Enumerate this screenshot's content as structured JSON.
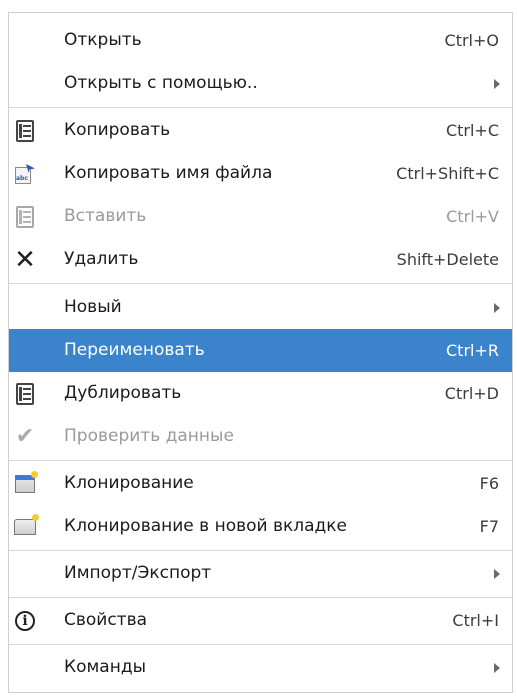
{
  "menu": {
    "items": [
      {
        "label": "Открыть",
        "shortcut": "Ctrl+O",
        "icon": "",
        "disabled": false,
        "submenu": false
      },
      {
        "label": "Открыть с помощью..",
        "shortcut": "",
        "icon": "",
        "disabled": false,
        "submenu": true
      },
      {
        "label": "Копировать",
        "shortcut": "Ctrl+C",
        "icon": "copy-icon",
        "disabled": false,
        "submenu": false
      },
      {
        "label": "Копировать имя файла",
        "shortcut": "Ctrl+Shift+C",
        "icon": "copy-filename-icon",
        "disabled": false,
        "submenu": false
      },
      {
        "label": "Вставить",
        "shortcut": "Ctrl+V",
        "icon": "paste-icon",
        "disabled": true,
        "submenu": false
      },
      {
        "label": "Удалить",
        "shortcut": "Shift+Delete",
        "icon": "delete-icon",
        "disabled": false,
        "submenu": false
      },
      {
        "label": "Новый",
        "shortcut": "",
        "icon": "",
        "disabled": false,
        "submenu": true
      },
      {
        "label": "Переименовать",
        "shortcut": "Ctrl+R",
        "icon": "",
        "disabled": false,
        "submenu": false,
        "highlighted": true
      },
      {
        "label": "Дублировать",
        "shortcut": "Ctrl+D",
        "icon": "duplicate-icon",
        "disabled": false,
        "submenu": false
      },
      {
        "label": "Проверить данные",
        "shortcut": "",
        "icon": "check-icon",
        "disabled": true,
        "submenu": false
      },
      {
        "label": "Клонирование",
        "shortcut": "F6",
        "icon": "clone-icon",
        "disabled": false,
        "submenu": false
      },
      {
        "label": "Клонирование в новой вкладке",
        "shortcut": "F7",
        "icon": "clone-tab-icon",
        "disabled": false,
        "submenu": false
      },
      {
        "label": "Импорт/Экспорт",
        "shortcut": "",
        "icon": "",
        "disabled": false,
        "submenu": true
      },
      {
        "label": "Свойства",
        "shortcut": "Ctrl+I",
        "icon": "info-icon",
        "disabled": false,
        "submenu": false
      },
      {
        "label": "Команды",
        "shortcut": "",
        "icon": "",
        "disabled": false,
        "submenu": true
      }
    ]
  },
  "colors": {
    "highlight": "#3b84cc",
    "disabled_text": "#9a9a9a",
    "text": "#1b1b1b"
  }
}
